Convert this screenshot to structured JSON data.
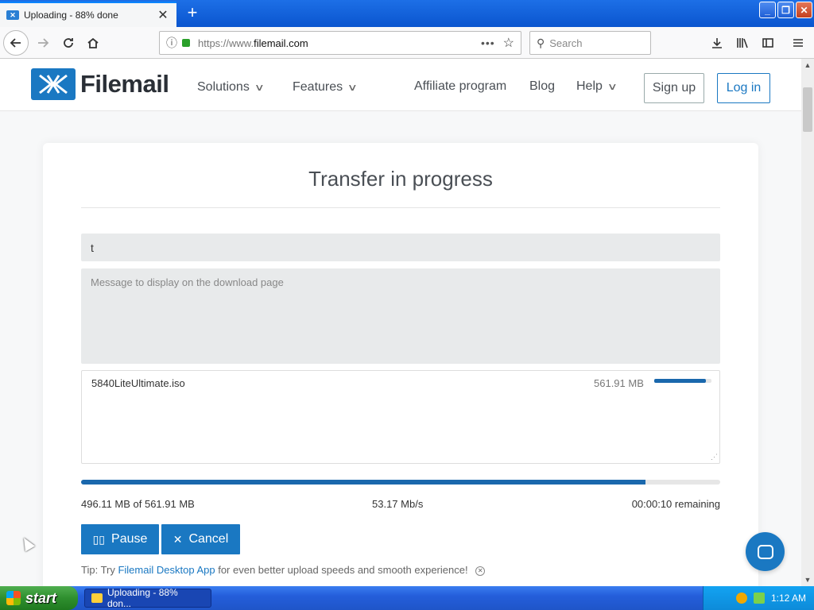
{
  "browser": {
    "tab_title": "Uploading - 88% done",
    "favicon_text": "✕",
    "close_glyph": "✕",
    "new_tab_glyph": "+",
    "url_prefix": "https://www.",
    "url_domain": "filemail.com",
    "page_actions": "•••",
    "search_placeholder": "Search",
    "window_buttons": [
      "_",
      "❐",
      "✕"
    ]
  },
  "site": {
    "brand": "Filemail",
    "nav": {
      "solutions": "Solutions",
      "features": "Features",
      "affiliate": "Affiliate program",
      "blog": "Blog",
      "help": "Help"
    },
    "signup": "Sign up",
    "login": "Log in"
  },
  "transfer": {
    "title": "Transfer in progress",
    "subject_value": "t",
    "message_placeholder": "Message to display on the download page",
    "file": {
      "name": "5840LiteUltimate.iso",
      "size": "561.91 MB",
      "progress": 0.9
    },
    "overall_progress": 0.883,
    "transferred": "496.11 MB of 561.91 MB",
    "speed": "53.17 Mb/s",
    "remaining": "00:00:10 remaining",
    "pause_label": "Pause",
    "cancel_label": "Cancel",
    "tip_prefix": "Tip: Try ",
    "tip_link": "Filemail Desktop App",
    "tip_suffix": " for even better upload speeds and smooth experience!"
  },
  "taskbar": {
    "start_label": "start",
    "task_label": "Uploading - 88% don...",
    "clock": "1:12 AM"
  },
  "colors": {
    "accent": "#1a78c2",
    "progress": "#1a68ad"
  }
}
